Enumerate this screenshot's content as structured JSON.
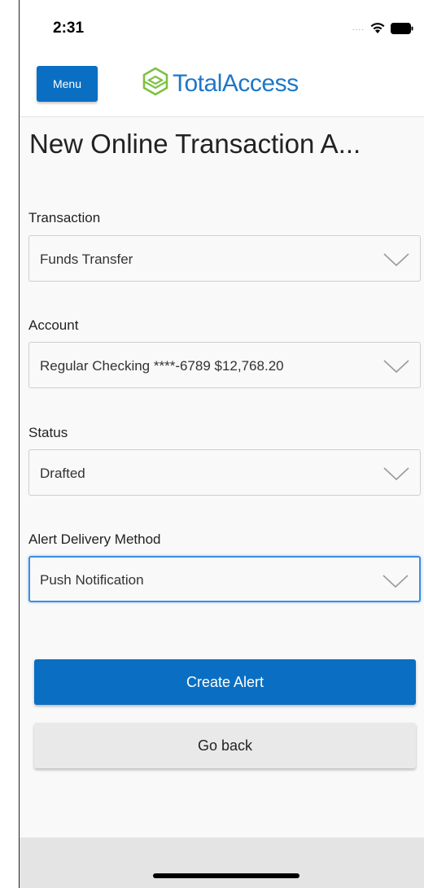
{
  "status_bar": {
    "time": "2:31",
    "signal_dots": "....",
    "icons": [
      "wifi-icon",
      "battery-icon"
    ]
  },
  "header": {
    "menu_label": "Menu",
    "logo_text": "TotalAccess",
    "logo_icon": "hexagon-logo-icon"
  },
  "page": {
    "title": "New Online Transaction A..."
  },
  "form": {
    "fields": [
      {
        "label": "Transaction",
        "value": "Funds Transfer"
      },
      {
        "label": "Account",
        "value": "Regular Checking ****-6789 $12,768.20"
      },
      {
        "label": "Status",
        "value": "Drafted"
      },
      {
        "label": "Alert Delivery Method",
        "value": "Push Notification"
      }
    ]
  },
  "actions": {
    "create_label": "Create Alert",
    "back_label": "Go back"
  },
  "colors": {
    "primary": "#0a6fc2",
    "logo_blue": "#1e77c8",
    "logo_green": "#7cc242",
    "focus": "#3b8fe0"
  }
}
